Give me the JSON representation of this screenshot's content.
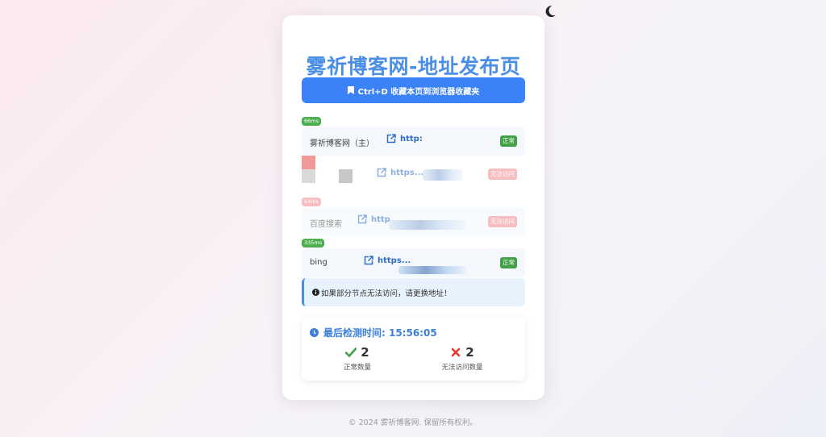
{
  "header": {
    "title": "雾祈博客网-地址发布页"
  },
  "bookmark": {
    "label": "Ctrl+D 收藏本页到浏览器收藏夹"
  },
  "nodes": [
    {
      "latency": "66ms",
      "name": "雾祈博客网（主）",
      "link": "http:",
      "status": "正常",
      "ok": true
    },
    {
      "latency": "",
      "name": "",
      "link": "https...",
      "status": "无法访问",
      "ok": false
    },
    {
      "latency": "64ms",
      "name": "百度搜索",
      "link": "http",
      "status": "无法访问",
      "ok": false
    },
    {
      "latency": "335ms",
      "name": "bing",
      "link": "https...",
      "status": "正常",
      "ok": true
    }
  ],
  "notice": {
    "text": "如果部分节点无法访问，请更换地址！"
  },
  "summary": {
    "last_check_label": "最后检测时间: 15:56:05",
    "ok_count": "2",
    "ok_label": "正常数量",
    "fail_count": "2",
    "fail_label": "无法访问数量"
  },
  "footer": {
    "text": "© 2024 雾祈博客网. 保留所有权利。"
  },
  "colors": {
    "accent": "#3b82f6",
    "ok": "#43a047",
    "fail": "#ef8a8a"
  },
  "icons": [
    "moon-icon",
    "bookmark-icon",
    "external-link-icon",
    "info-icon",
    "clock-icon",
    "check-icon",
    "cross-icon"
  ]
}
